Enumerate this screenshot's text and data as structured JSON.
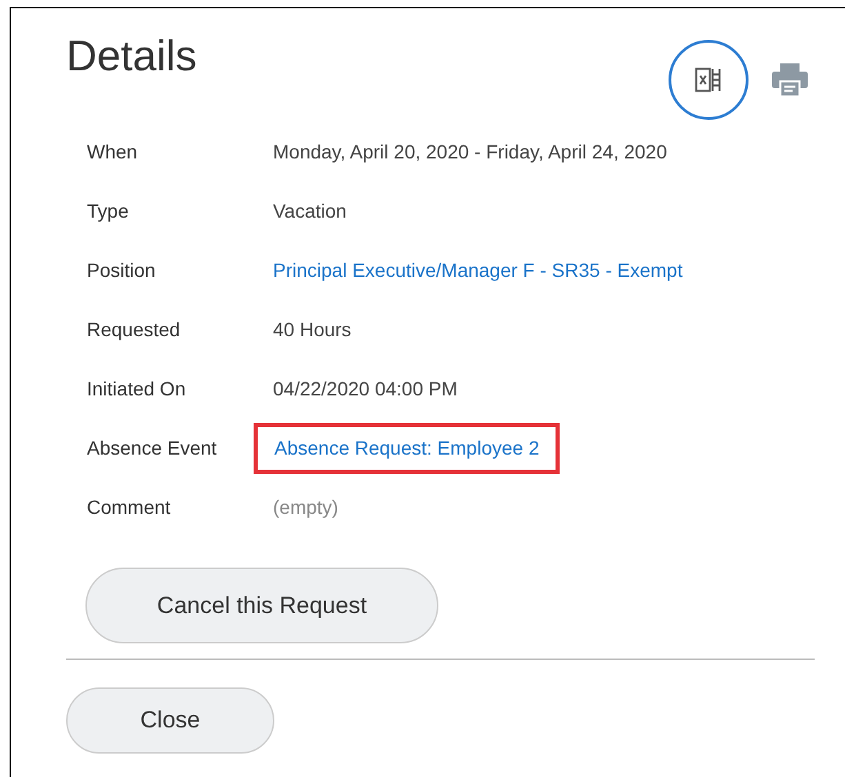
{
  "title": "Details",
  "toolbar": [
    {
      "kind": "export",
      "selected": true
    },
    {
      "kind": "print",
      "selected": false
    }
  ],
  "fields": [
    {
      "label": "When",
      "value": "Monday, April 20, 2020 - Friday, April 24, 2020",
      "kind": "text",
      "highlighted": false
    },
    {
      "label": "Type",
      "value": "Vacation",
      "kind": "text",
      "highlighted": false
    },
    {
      "label": "Position",
      "value": "Principal Executive/Manager F - SR35 - Exempt",
      "kind": "link",
      "highlighted": false
    },
    {
      "label": "Requested",
      "value": "40 Hours",
      "kind": "text",
      "highlighted": false
    },
    {
      "label": "Initiated On",
      "value": "04/22/2020 04:00 PM",
      "kind": "text",
      "highlighted": false
    },
    {
      "label": "Absence Event",
      "value": "Absence Request: Employee 2",
      "kind": "link",
      "highlighted": true
    },
    {
      "label": "Comment",
      "value": "(empty)",
      "kind": "empty",
      "highlighted": false
    }
  ],
  "action_button": "Cancel this Request",
  "close_button": "Close"
}
